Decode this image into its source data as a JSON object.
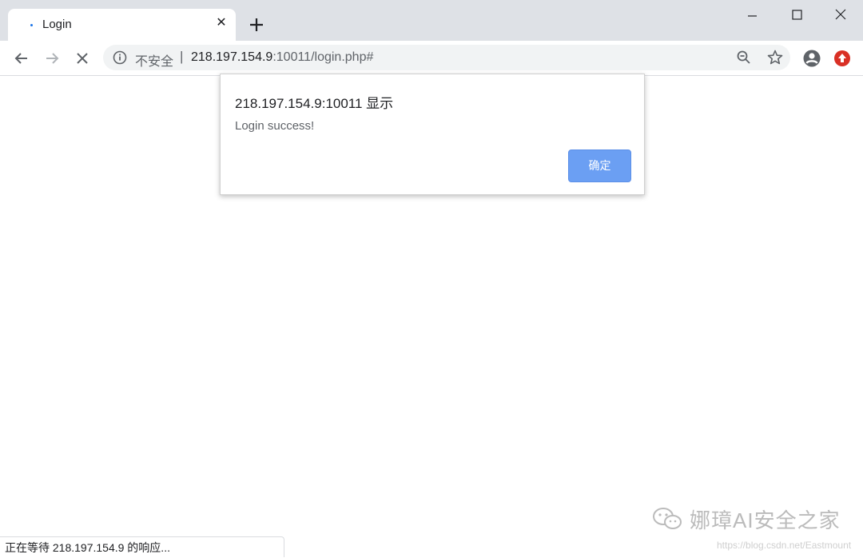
{
  "tab": {
    "title": "Login",
    "close_glyph": "✕"
  },
  "toolbar": {
    "insecure_label": "不安全",
    "separator": "|",
    "url_host": "218.197.154.9",
    "url_rest": ":10011/login.php#"
  },
  "dialog": {
    "title": "218.197.154.9:10011 显示",
    "message": "Login success!",
    "ok_label": "确定"
  },
  "status": {
    "text": "正在等待 218.197.154.9 的响应..."
  },
  "watermark": {
    "text": "娜璋AI安全之家",
    "url": "https://blog.csdn.net/Eastmount"
  },
  "icons": [
    "favicon-icon",
    "close-icon",
    "plus-icon",
    "minimize-icon",
    "maximize-icon",
    "window-close-icon",
    "back-arrow-icon",
    "forward-arrow-icon",
    "stop-icon",
    "info-icon",
    "zoom-icon",
    "star-icon",
    "profile-icon",
    "extension-icon",
    "wechat-icon"
  ],
  "colors": {
    "accent": "#1a73e8",
    "ok_button": "#6b9ff3",
    "extension": "#d93025"
  }
}
